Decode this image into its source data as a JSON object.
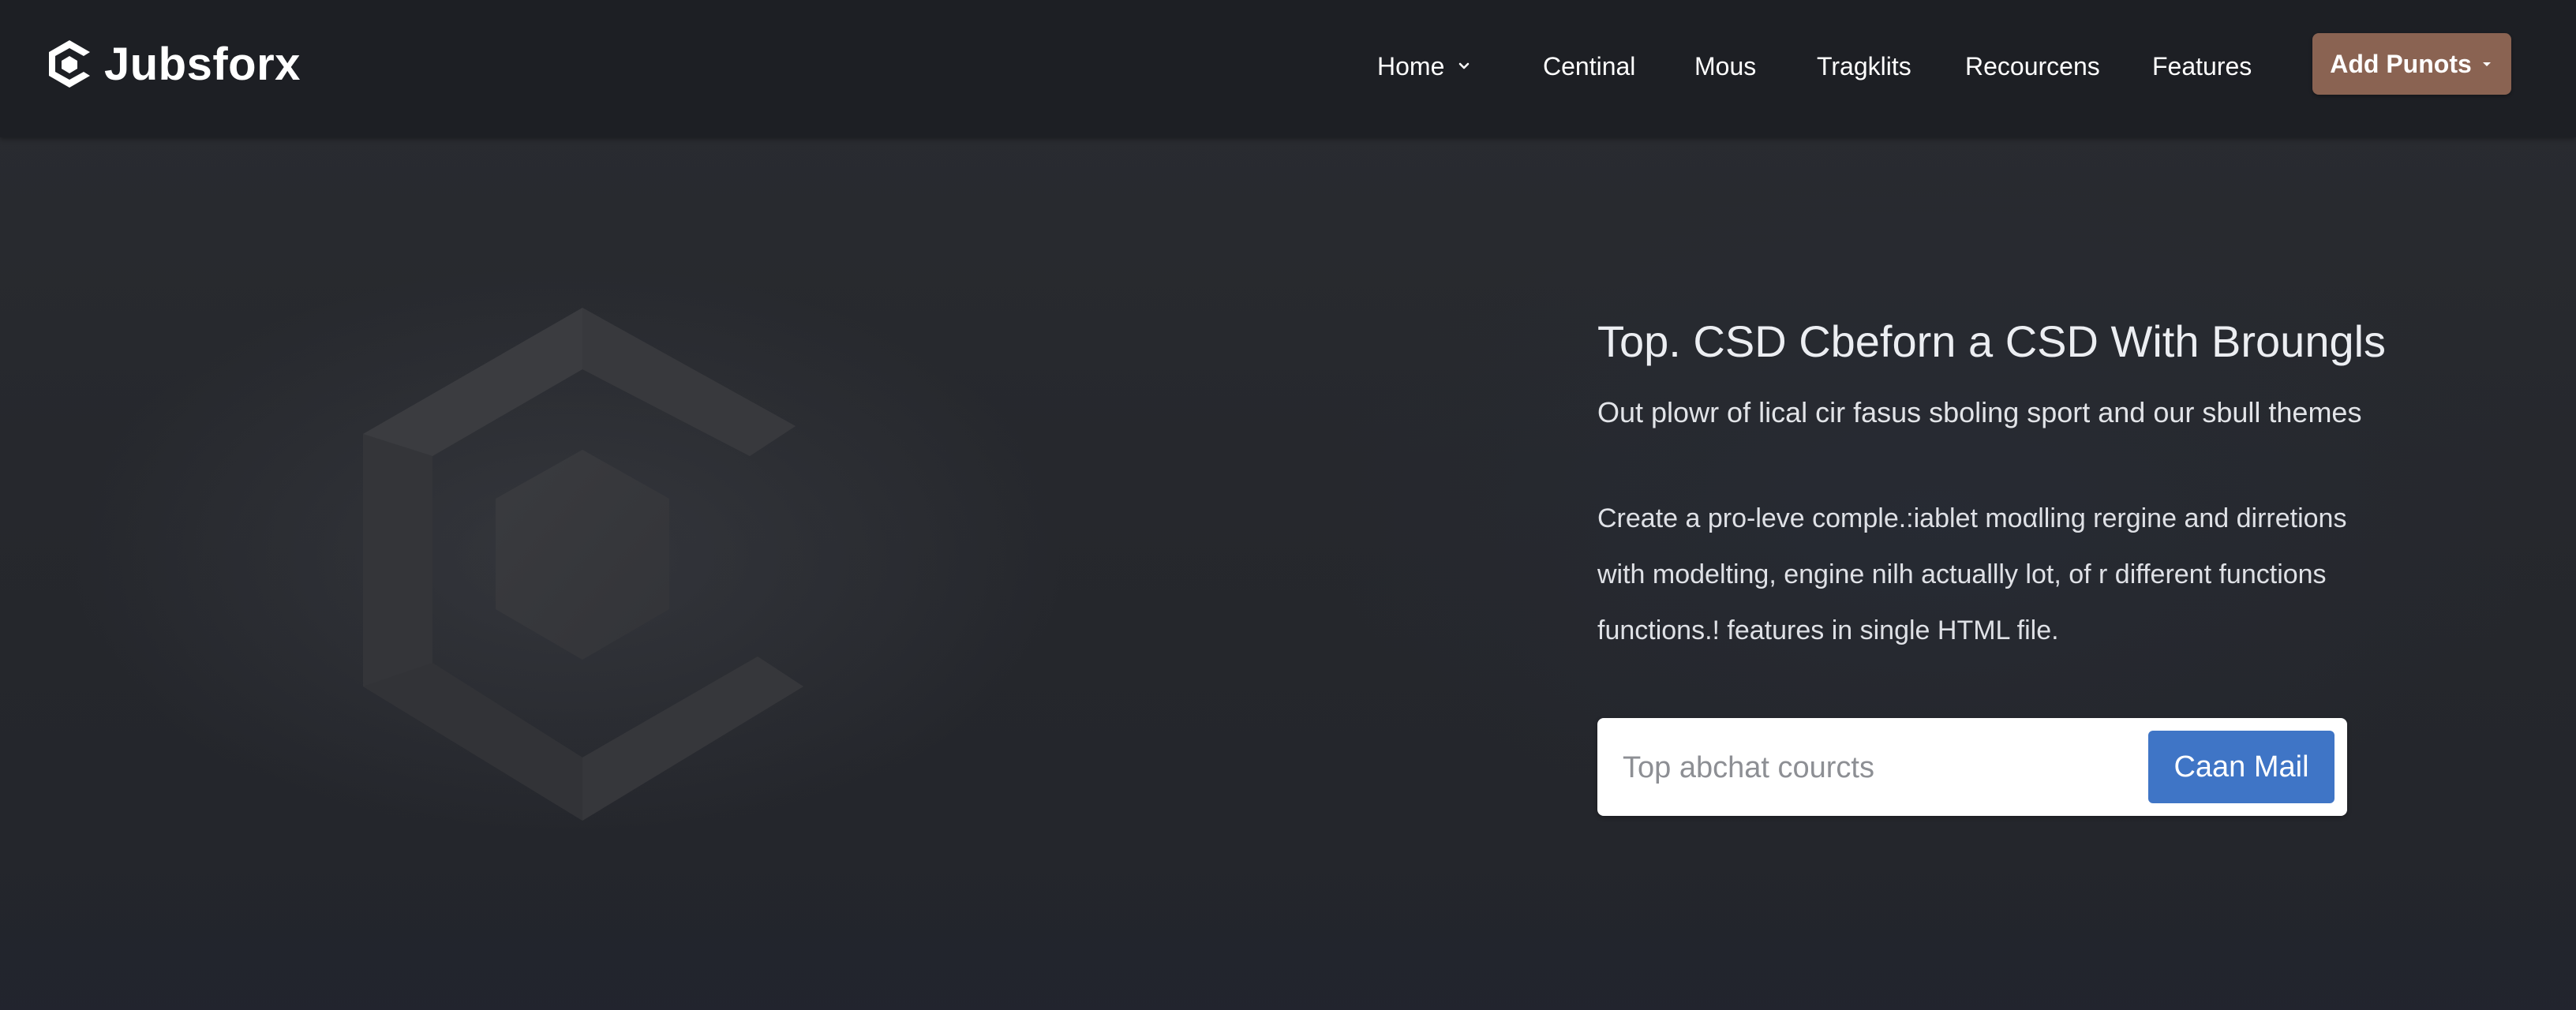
{
  "brand": {
    "name": "Jubsforx",
    "logo_icon": "hex-c-logo-icon"
  },
  "nav": {
    "items": [
      {
        "label": "Home",
        "has_dropdown": true
      },
      {
        "label": "Centinal"
      },
      {
        "label": "Mous"
      },
      {
        "label": "Tragklits"
      },
      {
        "label": "Recourcens"
      },
      {
        "label": "Features"
      }
    ],
    "cta": {
      "label": "Add Punots",
      "has_dropdown": true,
      "color": "#8a6352"
    }
  },
  "hero": {
    "illustration_icon": "hex-c-logo-icon",
    "headline": "Top. CSD Cbeforn a CSD With Broungls",
    "subline": "Out plowr of lical cir fasus sboling sport and our sbull themes",
    "description_lines": [
      "Create a pro-leve comple.:iablet moαlling rergine and dirretions",
      "with modelting, engine nilh actuallly lot, of r different functions",
      "functions.! features in single HTML file."
    ],
    "search": {
      "placeholder": "Top abchat courcts",
      "value": "",
      "button_label": "Caan Mail",
      "button_color": "#3f75c6"
    }
  },
  "colors": {
    "navbar_bg": "#1d1f24",
    "hero_bg": "#26282d",
    "accent_blue": "#3f75c6",
    "accent_brown": "#8a6352"
  }
}
